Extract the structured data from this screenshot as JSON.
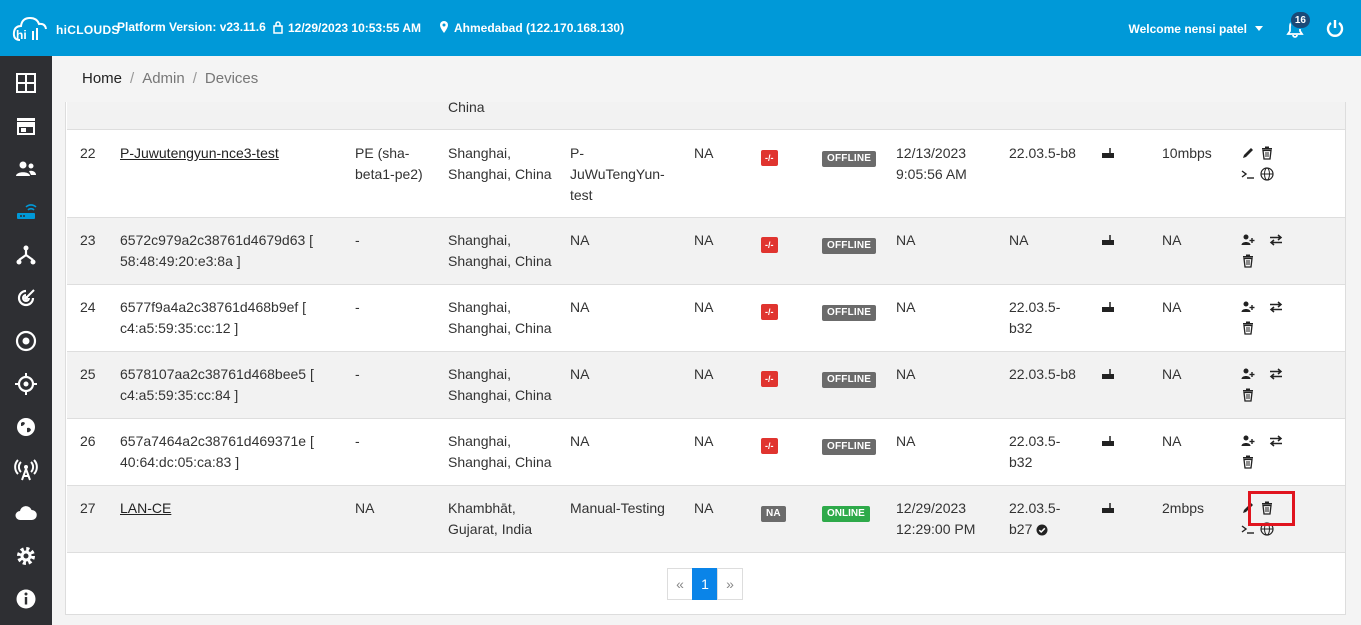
{
  "header": {
    "brand": "hiCLOUDS",
    "platform_version": "Platform Version: v23.11.6",
    "datetime": "12/29/2023 10:53:55 AM",
    "location": "Ahmedabad (122.170.168.130)",
    "welcome": "Welcome nensi patel",
    "notification_count": "16"
  },
  "breadcrumb": {
    "home": "Home",
    "admin": "Admin",
    "current": "Devices"
  },
  "table": {
    "partial_top_text": "China",
    "rows": [
      {
        "num": "22",
        "name": "P-Juwutengyun-nce3-test",
        "name_link": true,
        "type1": "PE (sha-",
        "type2": "beta1-pe2)",
        "loc1": "Shanghai,",
        "loc2": "Shanghai, China",
        "grp1": "P-",
        "grp2": "JuWuTengYun-",
        "grp3": "test",
        "col5": "NA",
        "ip": "-/-",
        "status": "OFFLINE",
        "seen1": "12/13/2023",
        "seen2": "9:05:56 AM",
        "fw1": "22.03.5-b8",
        "fw2": "",
        "bw": "10mbps"
      },
      {
        "num": "23",
        "name": "6572c979a2c38761d4679d63 [",
        "name2": "58:48:49:20:e3:8a ]",
        "type1": "-",
        "loc1": "Shanghai,",
        "loc2": "Shanghai, China",
        "grp1": "NA",
        "col5": "NA",
        "ip": "-/-",
        "status": "OFFLINE",
        "seen1": "NA",
        "fw1": "NA",
        "bw": "NA"
      },
      {
        "num": "24",
        "name": "6577f9a4a2c38761d468b9ef [",
        "name2": "c4:a5:59:35:cc:12 ]",
        "type1": "-",
        "loc1": "Shanghai,",
        "loc2": "Shanghai, China",
        "grp1": "NA",
        "col5": "NA",
        "ip": "-/-",
        "status": "OFFLINE",
        "seen1": "NA",
        "fw1": "22.03.5-",
        "fw2": "b32",
        "bw": "NA"
      },
      {
        "num": "25",
        "name": "6578107aa2c38761d468bee5 [",
        "name2": "c4:a5:59:35:cc:84 ]",
        "type1": "-",
        "loc1": "Shanghai,",
        "loc2": "Shanghai, China",
        "grp1": "NA",
        "col5": "NA",
        "ip": "-/-",
        "status": "OFFLINE",
        "seen1": "NA",
        "fw1": "22.03.5-b8",
        "bw": "NA"
      },
      {
        "num": "26",
        "name": "657a7464a2c38761d469371e [",
        "name2": "40:64:dc:05:ca:83 ]",
        "type1": "-",
        "loc1": "Shanghai,",
        "loc2": "Shanghai, China",
        "grp1": "NA",
        "col5": "NA",
        "ip": "-/-",
        "status": "OFFLINE",
        "seen1": "NA",
        "fw1": "22.03.5-",
        "fw2": "b32",
        "bw": "NA"
      },
      {
        "num": "27",
        "name": "LAN-CE",
        "type1": "NA",
        "loc1": "Khambhāt,",
        "loc2": "Gujarat, India",
        "grp1": "Manual-Testing",
        "col5": "NA",
        "ip": "NA",
        "status": "ONLINE",
        "seen1": "12/29/2023",
        "seen2": "12:29:00 PM",
        "fw1": "22.03.5-",
        "fw2": "b27",
        "bw": "2mbps"
      }
    ]
  },
  "pagination": {
    "prev": "«",
    "page": "1",
    "next": "»"
  },
  "colors": {
    "primary": "#0099d8",
    "sidebar": "#2e2f33",
    "danger": "#e0342f",
    "success": "#2eaa4a"
  }
}
